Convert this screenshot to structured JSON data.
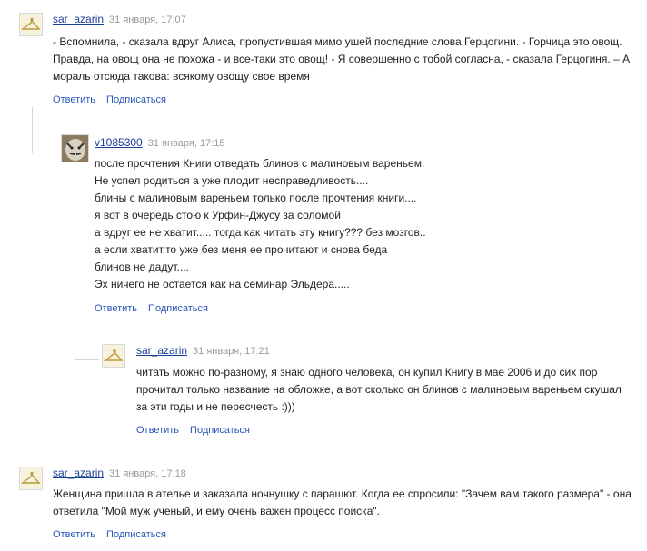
{
  "labels": {
    "reply": "Ответить",
    "subscribe": "Подписаться"
  },
  "comments": [
    {
      "author": "sar_azarin",
      "date": "31 января, 17:07",
      "avatar": "hanger-avatar",
      "lines": [
        "- Вспомнила, - сказала вдруг Алиса, пропустившая мимо ушей последние слова Герцогини. - Горчица это овощ.",
        "Правда, на овощ она не похожа - и все-таки это овощ! - Я совершенно с тобой согласна, - сказала Герцогиня. – А",
        "мораль отсюда такова: всякому овощу свое время"
      ]
    },
    {
      "author": "v1085300",
      "date": "31 января, 17:15",
      "avatar": "tiger-avatar",
      "lines": [
        "после прочтения Книги отведать блинов с малиновым вареньем.",
        "Не успел родиться а уже плодит несправедливость....",
        "блины с малиновым вареньем только после прочтения книги....",
        "я вот в очередь стою к Урфин-Джусу за соломой",
        "а вдруг ее не хватит..... тогда как читать эту книгу??? без мозгов..",
        "а если хватит.то уже без меня ее прочитают и снова беда",
        "блинов не дадут....",
        "Эх ничего не остается как на семинар Эльдера....."
      ]
    },
    {
      "author": "sar_azarin",
      "date": "31 января, 17:21",
      "avatar": "hanger-avatar",
      "lines": [
        "читать можно по-разному, я знаю одного человека, он купил Книгу в мае 2006 и до сих пор",
        "прочитал только название на обложке, а вот сколько он блинов с малиновым вареньем скушал",
        "за эти годы и не пересчесть :)))"
      ]
    },
    {
      "author": "sar_azarin",
      "date": "31 января, 17:18",
      "avatar": "hanger-avatar",
      "lines": [
        "Женщина пришла в ателье и заказала ночнушку с парашют. Когда ее спросили: \"Зачем вам такого размера\" - она",
        "ответила \"Мой муж ученый, и ему очень важен процесс поиска\"."
      ]
    }
  ]
}
